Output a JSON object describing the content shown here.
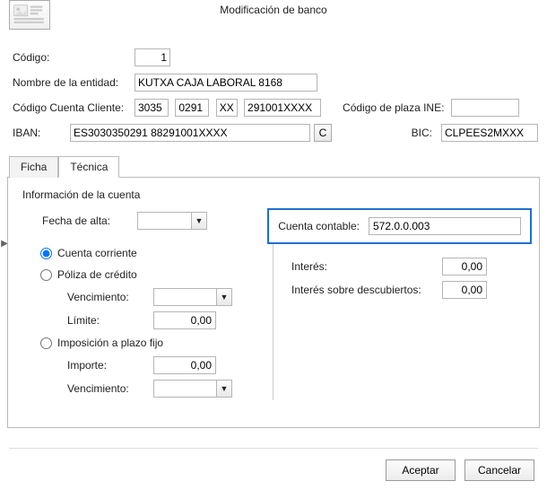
{
  "title": "Modificación de banco",
  "labels": {
    "codigo": "Código:",
    "nombre": "Nombre de la entidad:",
    "ccc": "Código Cuenta Cliente:",
    "plaza": "Código de plaza INE:",
    "iban": "IBAN:",
    "bic": "BIC:"
  },
  "fields": {
    "codigo": "1",
    "nombre": "KUTXA CAJA LABORAL 8168",
    "ccc_banco": "3035",
    "ccc_oficina": "0291",
    "ccc_dc": "XX",
    "ccc_cuenta": "291001XXXX",
    "plaza": "",
    "iban": "ES3030350291 88291001XXXX",
    "bic": "CLPEES2MXXX",
    "calc_btn": "C"
  },
  "tabs": {
    "ficha": "Ficha",
    "tecnica": "Técnica"
  },
  "tecnica": {
    "section": "Información de la cuenta",
    "fecha_alta_label": "Fecha de alta:",
    "fecha_alta": "",
    "cuenta_contable_label": "Cuenta contable:",
    "cuenta_contable": "572.0.0.003",
    "radios": {
      "corriente": "Cuenta corriente",
      "poliza": "Póliza de crédito",
      "plazo": "Imposición a plazo fijo"
    },
    "sub": {
      "vencimiento": "Vencimiento:",
      "limite": "Límite:",
      "limite_val": "0,00",
      "importe": "Importe:",
      "importe_val": "0,00"
    },
    "right": {
      "interes": "Interés:",
      "interes_val": "0,00",
      "interes_desc": "Interés sobre descubiertos:",
      "interes_desc_val": "0,00"
    }
  },
  "buttons": {
    "aceptar": "Aceptar",
    "cancelar": "Cancelar"
  }
}
